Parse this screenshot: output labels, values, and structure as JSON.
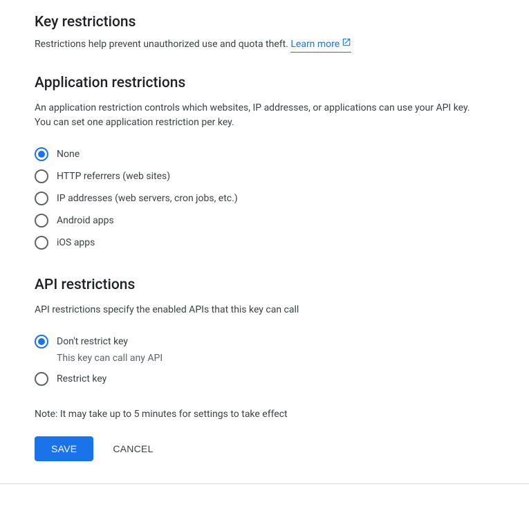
{
  "key_restrictions": {
    "title": "Key restrictions",
    "desc": "Restrictions help prevent unauthorized use and quota theft. ",
    "learn_more": "Learn more"
  },
  "application_restrictions": {
    "title": "Application restrictions",
    "desc": "An application restriction controls which websites, IP addresses, or applications can use your API key. You can set one application restriction per key.",
    "options": [
      {
        "label": "None",
        "selected": true
      },
      {
        "label": "HTTP referrers (web sites)",
        "selected": false
      },
      {
        "label": "IP addresses (web servers, cron jobs, etc.)",
        "selected": false
      },
      {
        "label": "Android apps",
        "selected": false
      },
      {
        "label": "iOS apps",
        "selected": false
      }
    ]
  },
  "api_restrictions": {
    "title": "API restrictions",
    "desc": "API restrictions specify the enabled APIs that this key can call",
    "options": [
      {
        "label": "Don't restrict key",
        "sublabel": "This key can call any API",
        "selected": true
      },
      {
        "label": "Restrict key",
        "selected": false
      }
    ]
  },
  "note": "Note: It may take up to 5 minutes for settings to take effect",
  "buttons": {
    "save": "Save",
    "cancel": "Cancel"
  }
}
